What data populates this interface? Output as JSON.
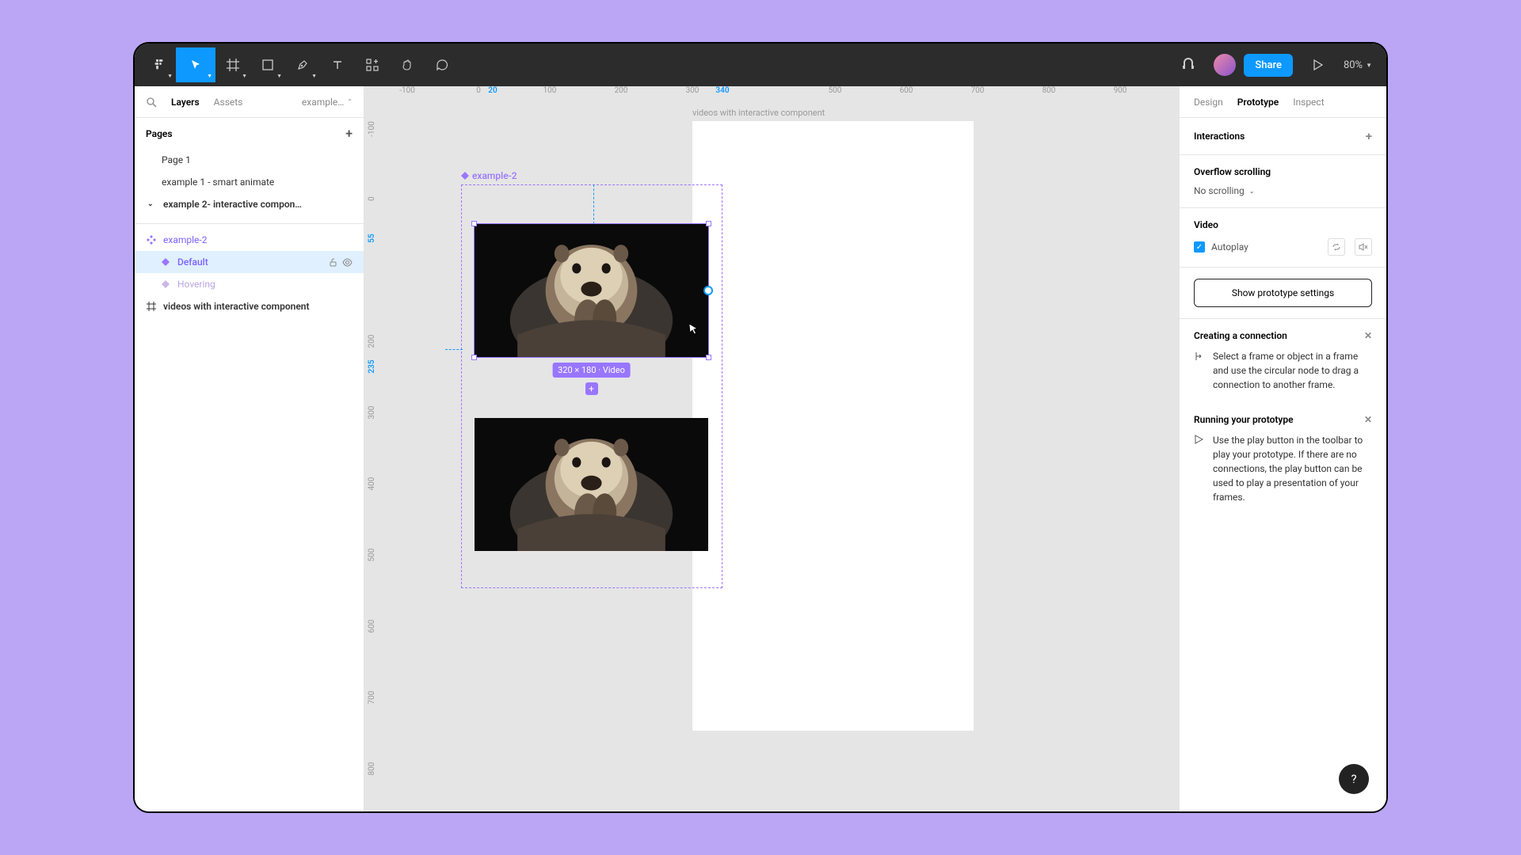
{
  "toolbar": {
    "share_label": "Share",
    "zoom": "80%"
  },
  "left": {
    "tabs": {
      "layers": "Layers",
      "assets": "Assets"
    },
    "breadcrumb": "example…",
    "pages_title": "Pages",
    "pages": [
      {
        "label": "Page 1"
      },
      {
        "label": "example 1 - smart animate"
      },
      {
        "label": "example 2- interactive compon…",
        "hasChevron": true,
        "bold": true
      }
    ],
    "layers": [
      {
        "label": "example-2",
        "type": "component-set"
      },
      {
        "label": "Default",
        "type": "variant"
      },
      {
        "label": "Hovering",
        "type": "variant-dim"
      },
      {
        "label": "videos with interactive component",
        "type": "frame"
      }
    ]
  },
  "canvas": {
    "frame_title": "videos with interactive component",
    "component_label": "example-2",
    "dim_label": "320 × 180 · Video",
    "ruler_h": [
      {
        "v": "-100",
        "hl": false,
        "pos": 30
      },
      {
        "v": "0",
        "hl": false,
        "pos": 120
      },
      {
        "v": "20",
        "hl": true,
        "pos": 138
      },
      {
        "v": "100",
        "hl": false,
        "pos": 210
      },
      {
        "v": "200",
        "hl": false,
        "pos": 300
      },
      {
        "v": "300",
        "hl": false,
        "pos": 390
      },
      {
        "v": "340",
        "hl": true,
        "pos": 428
      },
      {
        "v": "500",
        "hl": false,
        "pos": 570
      },
      {
        "v": "600",
        "hl": false,
        "pos": 660
      },
      {
        "v": "700",
        "hl": false,
        "pos": 750
      },
      {
        "v": "800",
        "hl": false,
        "pos": 840
      },
      {
        "v": "900",
        "hl": false,
        "pos": 930
      }
    ],
    "ruler_v": [
      {
        "v": "-100",
        "hl": false,
        "pos": 30
      },
      {
        "v": "0",
        "hl": false,
        "pos": 118
      },
      {
        "v": "55",
        "hl": true,
        "pos": 168
      },
      {
        "v": "200",
        "hl": false,
        "pos": 298
      },
      {
        "v": "235",
        "hl": true,
        "pos": 330
      },
      {
        "v": "300",
        "hl": false,
        "pos": 388
      },
      {
        "v": "400",
        "hl": false,
        "pos": 478
      },
      {
        "v": "500",
        "hl": false,
        "pos": 568
      },
      {
        "v": "600",
        "hl": false,
        "pos": 658
      },
      {
        "v": "700",
        "hl": false,
        "pos": 748
      },
      {
        "v": "800",
        "hl": false,
        "pos": 838
      }
    ]
  },
  "right": {
    "tabs": {
      "design": "Design",
      "prototype": "Prototype",
      "inspect": "Inspect"
    },
    "interactions": "Interactions",
    "overflow_title": "Overflow scrolling",
    "overflow_value": "No scrolling",
    "video_title": "Video",
    "autoplay": "Autoplay",
    "proto_btn": "Show prototype settings",
    "help_conn_title": "Creating a connection",
    "help_conn_text": "Select a frame or object in a frame and use the circular node to drag a connection to another frame.",
    "help_run_title": "Running your prototype",
    "help_run_text": "Use the play button in the toolbar to play your prototype. If there are no connections, the play button can be used to play a presentation of your frames."
  }
}
